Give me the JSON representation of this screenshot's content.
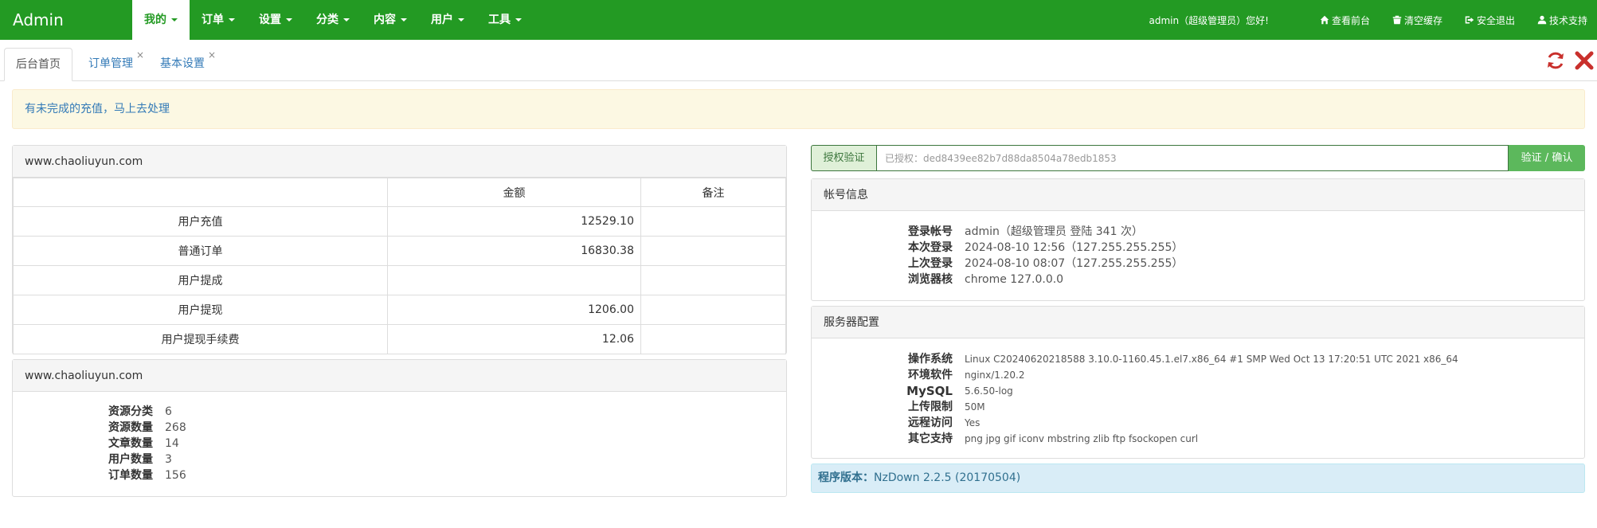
{
  "navbar": {
    "brand": "Admin",
    "menu": [
      "我的",
      "订单",
      "设置",
      "分类",
      "内容",
      "用户",
      "工具"
    ],
    "greeting": "admin（超级管理员）您好!",
    "right_links": [
      {
        "label": "查看前台",
        "icon": "home-icon"
      },
      {
        "label": "清空缓存",
        "icon": "trash-icon"
      },
      {
        "label": "安全退出",
        "icon": "sign-out-icon"
      },
      {
        "label": "技术支持",
        "icon": "user-icon"
      }
    ]
  },
  "tabs": [
    {
      "label": "后台首页",
      "closable": false
    },
    {
      "label": "订单管理",
      "closable": true
    },
    {
      "label": "基本设置",
      "closable": true
    }
  ],
  "tab_close_glyph": "×",
  "tools": {
    "refresh_icon": "refresh-icon",
    "close_icon": "close-icon"
  },
  "alert": "有未完成的充值，马上去处理",
  "finance": {
    "heading": "www.chaoliuyun.com",
    "columns": [
      "",
      "金额",
      "备注"
    ],
    "rows": [
      {
        "label": "用户充值",
        "amount": "12529.10",
        "note": ""
      },
      {
        "label": "普通订单",
        "amount": "16830.38",
        "note": ""
      },
      {
        "label": "用户提成",
        "amount": "",
        "note": ""
      },
      {
        "label": "用户提现",
        "amount": "1206.00",
        "note": ""
      },
      {
        "label": "用户提现手续费",
        "amount": "12.06",
        "note": ""
      }
    ]
  },
  "stats": {
    "heading": "www.chaoliuyun.com",
    "items": [
      {
        "k": "资源分类",
        "v": "6"
      },
      {
        "k": "资源数量",
        "v": "268"
      },
      {
        "k": "文章数量",
        "v": "14"
      },
      {
        "k": "用户数量",
        "v": "3"
      },
      {
        "k": "订单数量",
        "v": "156"
      }
    ]
  },
  "auth": {
    "addon": "授权验证",
    "value": "已授权：ded8439ee82b7d88da8504a78edb1853",
    "button": "验证 / 确认"
  },
  "account": {
    "heading": "帐号信息",
    "items": [
      {
        "k": "登录帐号",
        "v": "admin（超级管理员 登陆 341 次）"
      },
      {
        "k": "本次登录",
        "v": "2024-08-10 12:56（127.255.255.255）"
      },
      {
        "k": "上次登录",
        "v": "2024-08-10 08:07（127.255.255.255）"
      },
      {
        "k": "浏览器核",
        "v": "chrome 127.0.0.0"
      }
    ]
  },
  "server": {
    "heading": "服务器配置",
    "items": [
      {
        "k": "操作系统",
        "v": "Linux C20240620218588 3.10.0-1160.45.1.el7.x86_64 #1 SMP Wed Oct 13 17:20:51 UTC 2021 x86_64"
      },
      {
        "k": "环境软件",
        "v": "nginx/1.20.2"
      },
      {
        "k": "MySQL",
        "v": "5.6.50-log"
      },
      {
        "k": "上传限制",
        "v": "50M"
      },
      {
        "k": "远程访问",
        "v": "Yes"
      },
      {
        "k": "其它支持",
        "v": "png jpg gif iconv mbstring zlib ftp fsockopen curl"
      }
    ]
  },
  "version": {
    "label": "程序版本：",
    "value": "NzDown 2.2.5 (20170504)"
  },
  "colors": {
    "nav_green": "#239a23",
    "link_blue": "#337ab7",
    "danger": "#c9302c"
  }
}
